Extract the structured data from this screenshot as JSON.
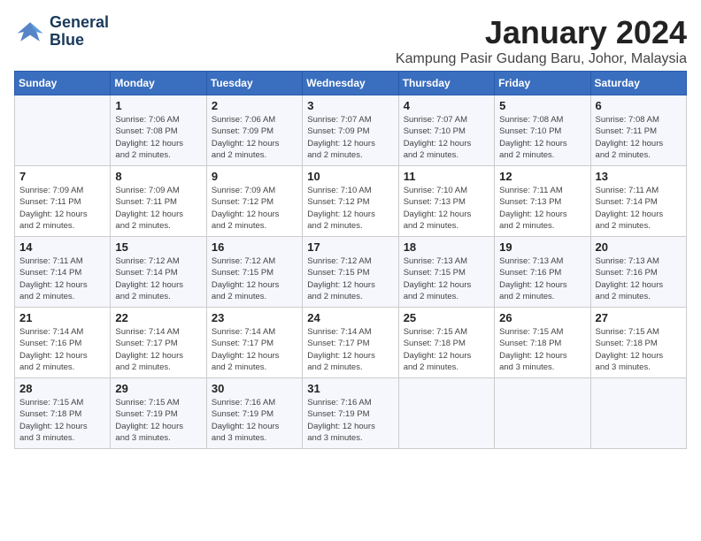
{
  "logo": {
    "line1": "General",
    "line2": "Blue"
  },
  "title": "January 2024",
  "subtitle": "Kampung Pasir Gudang Baru, Johor, Malaysia",
  "weekdays": [
    "Sunday",
    "Monday",
    "Tuesday",
    "Wednesday",
    "Thursday",
    "Friday",
    "Saturday"
  ],
  "weeks": [
    [
      {
        "day": "",
        "info": ""
      },
      {
        "day": "1",
        "info": "Sunrise: 7:06 AM\nSunset: 7:08 PM\nDaylight: 12 hours\nand 2 minutes."
      },
      {
        "day": "2",
        "info": "Sunrise: 7:06 AM\nSunset: 7:09 PM\nDaylight: 12 hours\nand 2 minutes."
      },
      {
        "day": "3",
        "info": "Sunrise: 7:07 AM\nSunset: 7:09 PM\nDaylight: 12 hours\nand 2 minutes."
      },
      {
        "day": "4",
        "info": "Sunrise: 7:07 AM\nSunset: 7:10 PM\nDaylight: 12 hours\nand 2 minutes."
      },
      {
        "day": "5",
        "info": "Sunrise: 7:08 AM\nSunset: 7:10 PM\nDaylight: 12 hours\nand 2 minutes."
      },
      {
        "day": "6",
        "info": "Sunrise: 7:08 AM\nSunset: 7:11 PM\nDaylight: 12 hours\nand 2 minutes."
      }
    ],
    [
      {
        "day": "7",
        "info": "Sunrise: 7:09 AM\nSunset: 7:11 PM\nDaylight: 12 hours\nand 2 minutes."
      },
      {
        "day": "8",
        "info": "Sunrise: 7:09 AM\nSunset: 7:11 PM\nDaylight: 12 hours\nand 2 minutes."
      },
      {
        "day": "9",
        "info": "Sunrise: 7:09 AM\nSunset: 7:12 PM\nDaylight: 12 hours\nand 2 minutes."
      },
      {
        "day": "10",
        "info": "Sunrise: 7:10 AM\nSunset: 7:12 PM\nDaylight: 12 hours\nand 2 minutes."
      },
      {
        "day": "11",
        "info": "Sunrise: 7:10 AM\nSunset: 7:13 PM\nDaylight: 12 hours\nand 2 minutes."
      },
      {
        "day": "12",
        "info": "Sunrise: 7:11 AM\nSunset: 7:13 PM\nDaylight: 12 hours\nand 2 minutes."
      },
      {
        "day": "13",
        "info": "Sunrise: 7:11 AM\nSunset: 7:14 PM\nDaylight: 12 hours\nand 2 minutes."
      }
    ],
    [
      {
        "day": "14",
        "info": "Sunrise: 7:11 AM\nSunset: 7:14 PM\nDaylight: 12 hours\nand 2 minutes."
      },
      {
        "day": "15",
        "info": "Sunrise: 7:12 AM\nSunset: 7:14 PM\nDaylight: 12 hours\nand 2 minutes."
      },
      {
        "day": "16",
        "info": "Sunrise: 7:12 AM\nSunset: 7:15 PM\nDaylight: 12 hours\nand 2 minutes."
      },
      {
        "day": "17",
        "info": "Sunrise: 7:12 AM\nSunset: 7:15 PM\nDaylight: 12 hours\nand 2 minutes."
      },
      {
        "day": "18",
        "info": "Sunrise: 7:13 AM\nSunset: 7:15 PM\nDaylight: 12 hours\nand 2 minutes."
      },
      {
        "day": "19",
        "info": "Sunrise: 7:13 AM\nSunset: 7:16 PM\nDaylight: 12 hours\nand 2 minutes."
      },
      {
        "day": "20",
        "info": "Sunrise: 7:13 AM\nSunset: 7:16 PM\nDaylight: 12 hours\nand 2 minutes."
      }
    ],
    [
      {
        "day": "21",
        "info": "Sunrise: 7:14 AM\nSunset: 7:16 PM\nDaylight: 12 hours\nand 2 minutes."
      },
      {
        "day": "22",
        "info": "Sunrise: 7:14 AM\nSunset: 7:17 PM\nDaylight: 12 hours\nand 2 minutes."
      },
      {
        "day": "23",
        "info": "Sunrise: 7:14 AM\nSunset: 7:17 PM\nDaylight: 12 hours\nand 2 minutes."
      },
      {
        "day": "24",
        "info": "Sunrise: 7:14 AM\nSunset: 7:17 PM\nDaylight: 12 hours\nand 2 minutes."
      },
      {
        "day": "25",
        "info": "Sunrise: 7:15 AM\nSunset: 7:18 PM\nDaylight: 12 hours\nand 2 minutes."
      },
      {
        "day": "26",
        "info": "Sunrise: 7:15 AM\nSunset: 7:18 PM\nDaylight: 12 hours\nand 3 minutes."
      },
      {
        "day": "27",
        "info": "Sunrise: 7:15 AM\nSunset: 7:18 PM\nDaylight: 12 hours\nand 3 minutes."
      }
    ],
    [
      {
        "day": "28",
        "info": "Sunrise: 7:15 AM\nSunset: 7:18 PM\nDaylight: 12 hours\nand 3 minutes."
      },
      {
        "day": "29",
        "info": "Sunrise: 7:15 AM\nSunset: 7:19 PM\nDaylight: 12 hours\nand 3 minutes."
      },
      {
        "day": "30",
        "info": "Sunrise: 7:16 AM\nSunset: 7:19 PM\nDaylight: 12 hours\nand 3 minutes."
      },
      {
        "day": "31",
        "info": "Sunrise: 7:16 AM\nSunset: 7:19 PM\nDaylight: 12 hours\nand 3 minutes."
      },
      {
        "day": "",
        "info": ""
      },
      {
        "day": "",
        "info": ""
      },
      {
        "day": "",
        "info": ""
      }
    ]
  ]
}
